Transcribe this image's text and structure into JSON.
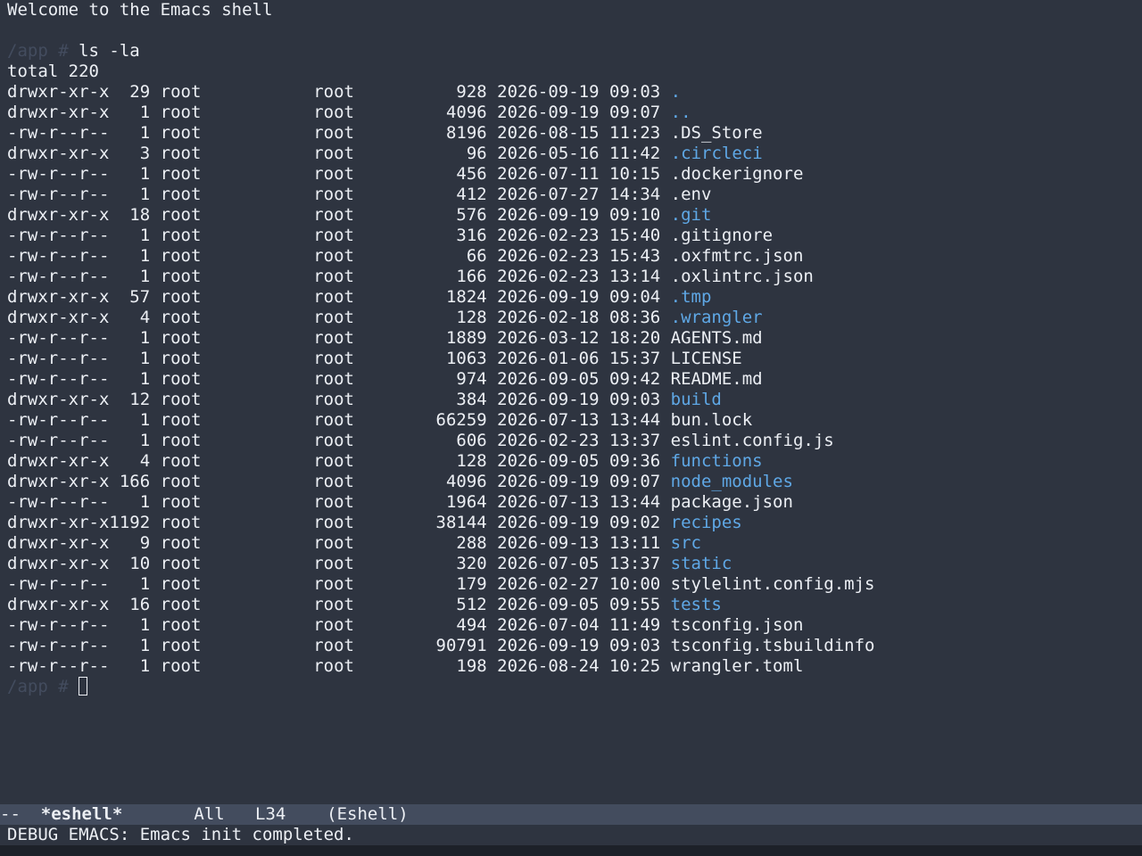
{
  "banner": "Welcome to the Emacs shell",
  "prompt": "/app # ",
  "command": "ls -la",
  "total": "total 220",
  "entries": [
    {
      "perm": "drwxr-xr-x",
      "links": "29",
      "owner": "root",
      "group": "root",
      "size": "928",
      "date": "2026-09-19",
      "time": "09:03",
      "name": ".",
      "is_dir": true
    },
    {
      "perm": "drwxr-xr-x",
      "links": "1",
      "owner": "root",
      "group": "root",
      "size": "4096",
      "date": "2026-09-19",
      "time": "09:07",
      "name": "..",
      "is_dir": true
    },
    {
      "perm": "-rw-r--r--",
      "links": "1",
      "owner": "root",
      "group": "root",
      "size": "8196",
      "date": "2026-08-15",
      "time": "11:23",
      "name": ".DS_Store",
      "is_dir": false
    },
    {
      "perm": "drwxr-xr-x",
      "links": "3",
      "owner": "root",
      "group": "root",
      "size": "96",
      "date": "2026-05-16",
      "time": "11:42",
      "name": ".circleci",
      "is_dir": true
    },
    {
      "perm": "-rw-r--r--",
      "links": "1",
      "owner": "root",
      "group": "root",
      "size": "456",
      "date": "2026-07-11",
      "time": "10:15",
      "name": ".dockerignore",
      "is_dir": false
    },
    {
      "perm": "-rw-r--r--",
      "links": "1",
      "owner": "root",
      "group": "root",
      "size": "412",
      "date": "2026-07-27",
      "time": "14:34",
      "name": ".env",
      "is_dir": false
    },
    {
      "perm": "drwxr-xr-x",
      "links": "18",
      "owner": "root",
      "group": "root",
      "size": "576",
      "date": "2026-09-19",
      "time": "09:10",
      "name": ".git",
      "is_dir": true
    },
    {
      "perm": "-rw-r--r--",
      "links": "1",
      "owner": "root",
      "group": "root",
      "size": "316",
      "date": "2026-02-23",
      "time": "15:40",
      "name": ".gitignore",
      "is_dir": false
    },
    {
      "perm": "-rw-r--r--",
      "links": "1",
      "owner": "root",
      "group": "root",
      "size": "66",
      "date": "2026-02-23",
      "time": "15:43",
      "name": ".oxfmtrc.json",
      "is_dir": false
    },
    {
      "perm": "-rw-r--r--",
      "links": "1",
      "owner": "root",
      "group": "root",
      "size": "166",
      "date": "2026-02-23",
      "time": "13:14",
      "name": ".oxlintrc.json",
      "is_dir": false
    },
    {
      "perm": "drwxr-xr-x",
      "links": "57",
      "owner": "root",
      "group": "root",
      "size": "1824",
      "date": "2026-09-19",
      "time": "09:04",
      "name": ".tmp",
      "is_dir": true
    },
    {
      "perm": "drwxr-xr-x",
      "links": "4",
      "owner": "root",
      "group": "root",
      "size": "128",
      "date": "2026-02-18",
      "time": "08:36",
      "name": ".wrangler",
      "is_dir": true
    },
    {
      "perm": "-rw-r--r--",
      "links": "1",
      "owner": "root",
      "group": "root",
      "size": "1889",
      "date": "2026-03-12",
      "time": "18:20",
      "name": "AGENTS.md",
      "is_dir": false
    },
    {
      "perm": "-rw-r--r--",
      "links": "1",
      "owner": "root",
      "group": "root",
      "size": "1063",
      "date": "2026-01-06",
      "time": "15:37",
      "name": "LICENSE",
      "is_dir": false
    },
    {
      "perm": "-rw-r--r--",
      "links": "1",
      "owner": "root",
      "group": "root",
      "size": "974",
      "date": "2026-09-05",
      "time": "09:42",
      "name": "README.md",
      "is_dir": false
    },
    {
      "perm": "drwxr-xr-x",
      "links": "12",
      "owner": "root",
      "group": "root",
      "size": "384",
      "date": "2026-09-19",
      "time": "09:03",
      "name": "build",
      "is_dir": true
    },
    {
      "perm": "-rw-r--r--",
      "links": "1",
      "owner": "root",
      "group": "root",
      "size": "66259",
      "date": "2026-07-13",
      "time": "13:44",
      "name": "bun.lock",
      "is_dir": false
    },
    {
      "perm": "-rw-r--r--",
      "links": "1",
      "owner": "root",
      "group": "root",
      "size": "606",
      "date": "2026-02-23",
      "time": "13:37",
      "name": "eslint.config.js",
      "is_dir": false
    },
    {
      "perm": "drwxr-xr-x",
      "links": "4",
      "owner": "root",
      "group": "root",
      "size": "128",
      "date": "2026-09-05",
      "time": "09:36",
      "name": "functions",
      "is_dir": true
    },
    {
      "perm": "drwxr-xr-x",
      "links": "166",
      "owner": "root",
      "group": "root",
      "size": "4096",
      "date": "2026-09-19",
      "time": "09:07",
      "name": "node_modules",
      "is_dir": true
    },
    {
      "perm": "-rw-r--r--",
      "links": "1",
      "owner": "root",
      "group": "root",
      "size": "1964",
      "date": "2026-07-13",
      "time": "13:44",
      "name": "package.json",
      "is_dir": false
    },
    {
      "perm": "drwxr-xr-x",
      "links": "1192",
      "owner": "root",
      "group": "root",
      "size": "38144",
      "date": "2026-09-19",
      "time": "09:02",
      "name": "recipes",
      "is_dir": true
    },
    {
      "perm": "drwxr-xr-x",
      "links": "9",
      "owner": "root",
      "group": "root",
      "size": "288",
      "date": "2026-09-13",
      "time": "13:11",
      "name": "src",
      "is_dir": true
    },
    {
      "perm": "drwxr-xr-x",
      "links": "10",
      "owner": "root",
      "group": "root",
      "size": "320",
      "date": "2026-07-05",
      "time": "13:37",
      "name": "static",
      "is_dir": true
    },
    {
      "perm": "-rw-r--r--",
      "links": "1",
      "owner": "root",
      "group": "root",
      "size": "179",
      "date": "2026-02-27",
      "time": "10:00",
      "name": "stylelint.config.mjs",
      "is_dir": false
    },
    {
      "perm": "drwxr-xr-x",
      "links": "16",
      "owner": "root",
      "group": "root",
      "size": "512",
      "date": "2026-09-05",
      "time": "09:55",
      "name": "tests",
      "is_dir": true
    },
    {
      "perm": "-rw-r--r--",
      "links": "1",
      "owner": "root",
      "group": "root",
      "size": "494",
      "date": "2026-07-04",
      "time": "11:49",
      "name": "tsconfig.json",
      "is_dir": false
    },
    {
      "perm": "-rw-r--r--",
      "links": "1",
      "owner": "root",
      "group": "root",
      "size": "90791",
      "date": "2026-09-19",
      "time": "09:03",
      "name": "tsconfig.tsbuildinfo",
      "is_dir": false
    },
    {
      "perm": "-rw-r--r--",
      "links": "1",
      "owner": "root",
      "group": "root",
      "size": "198",
      "date": "2026-08-24",
      "time": "10:25",
      "name": "wrangler.toml",
      "is_dir": false
    }
  ],
  "modeline": {
    "state": "--",
    "buffer": "*eshell*",
    "position": "All",
    "line": "L34",
    "mode": "(Eshell)"
  },
  "echo": "DEBUG EMACS: Emacs init completed.",
  "colors": {
    "background": "#2e3440",
    "foreground": "#eceff4",
    "directory": "#5fa8e6",
    "prompt": "#434c5e",
    "modeline_bg": "#434c5e"
  }
}
